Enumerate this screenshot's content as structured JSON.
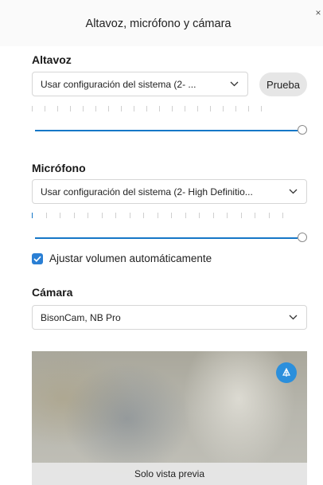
{
  "dialog": {
    "title": "Altavoz, micrófono y cámara",
    "close_icon": "close-icon"
  },
  "speaker": {
    "label": "Altavoz",
    "selected": "Usar configuración del sistema (2- ...",
    "test_label": "Prueba",
    "level": 0,
    "volume": 1.0
  },
  "microphone": {
    "label": "Micrófono",
    "selected": "Usar configuración del sistema (2- High Definitio...",
    "level": 0.02,
    "volume": 1.0,
    "auto_adjust_label": "Ajustar volumen automáticamente",
    "auto_adjust_checked": true
  },
  "camera": {
    "label": "Cámara",
    "selected": "BisonCam, NB Pro",
    "preview_caption": "Solo vista previa",
    "preview_button_icon": "background-effects-icon"
  },
  "colors": {
    "accent": "#1677c7",
    "checkbox": "#2a7fd4",
    "preview_button": "#2b8fdc"
  }
}
